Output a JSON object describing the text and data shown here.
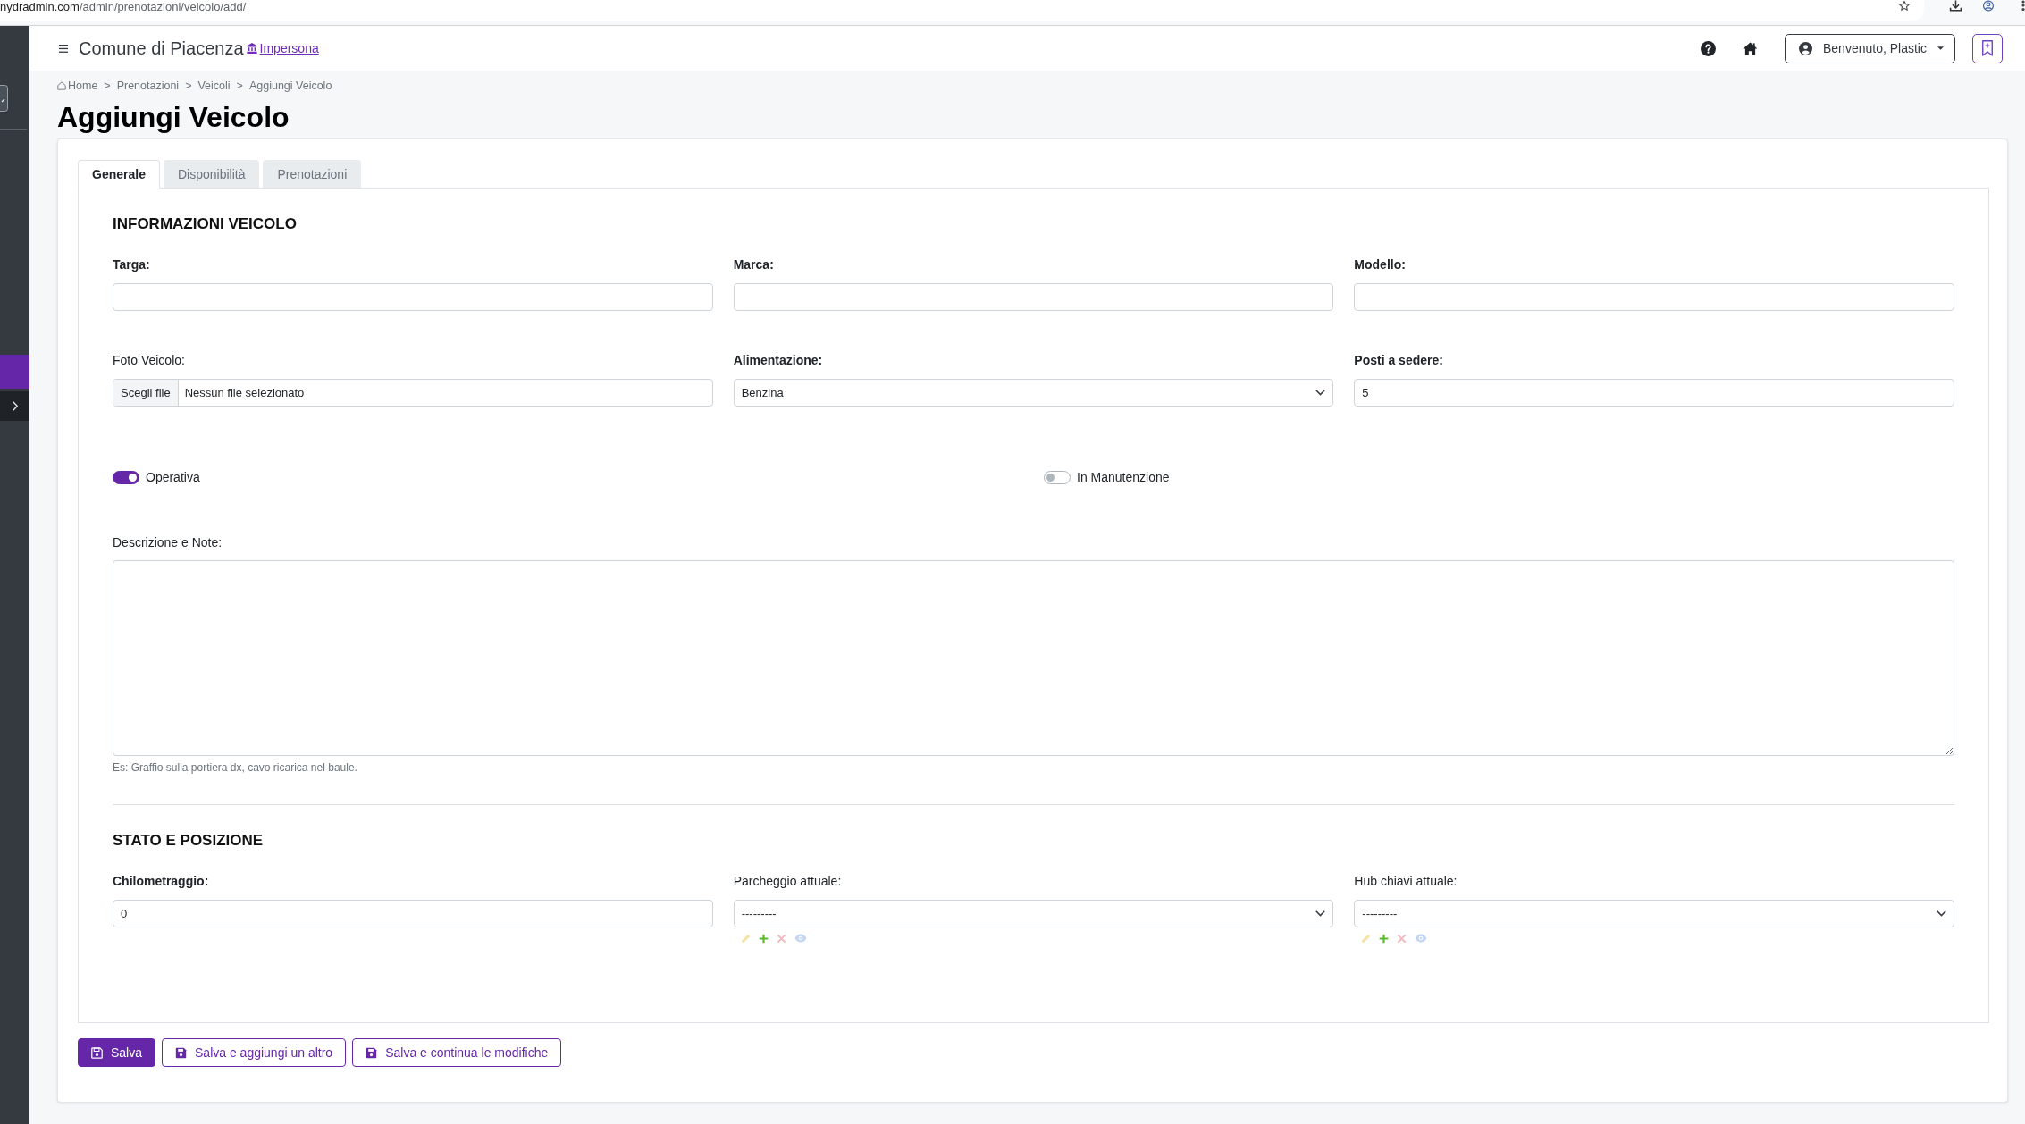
{
  "browser": {
    "address_host": "nydradmin.com",
    "address_path": "/admin/prenotazioni/veicolo/add/"
  },
  "sidebar": {
    "items": [
      {
        "selected": true
      }
    ]
  },
  "header": {
    "title": "Comune di Piacenza",
    "impersonate_link": "Impersona",
    "user_menu": "Benvenuto, Plastic"
  },
  "breadcrumb": [
    {
      "kind": "home",
      "label": "Home"
    },
    {
      "kind": "separator",
      "label": ">"
    },
    {
      "kind": "link",
      "label": "Prenotazioni"
    },
    {
      "kind": "separator",
      "label": ">"
    },
    {
      "kind": "link",
      "label": "Veicoli"
    },
    {
      "kind": "separator",
      "label": ">"
    },
    {
      "kind": "current",
      "label": "Aggiungi Veicolo"
    }
  ],
  "page_title": "Aggiungi Veicolo",
  "tabs": [
    {
      "label": "Generale",
      "selected": true
    },
    {
      "label": "Disponibilità",
      "selected": false
    },
    {
      "label": "Prenotazioni",
      "selected": false
    }
  ],
  "sections": [
    {
      "title": "INFORMAZIONI VEICOLO",
      "rows": [
        {
          "fields": [
            {
              "kind": "text",
              "label": "Targa:",
              "required": true
            },
            {
              "kind": "text",
              "label": "Marca:",
              "required": true
            },
            {
              "kind": "text",
              "label": "Modello:",
              "required": true
            }
          ]
        },
        {
          "fields": [
            {
              "kind": "file",
              "label": "Foto Veicolo:",
              "required": false,
              "button_label": "Scegli file",
              "value": "Nessun file selezionato"
            },
            {
              "kind": "select",
              "label": "Alimentazione:",
              "required": true,
              "value": "Benzina"
            },
            {
              "kind": "text",
              "label": "Posti a sedere:",
              "required": true,
              "value": "5"
            }
          ]
        },
        {
          "fields": [
            {
              "kind": "toggle",
              "label": "Operativa",
              "on": true
            },
            {
              "kind": "toggle",
              "label": "In Manutenzione",
              "on": false
            }
          ]
        },
        {
          "fields": [
            {
              "kind": "textarea",
              "label": "Descrizione e Note:",
              "required": false,
              "help": "Es: Graffio sulla portiera dx, cavo ricarica nel baule."
            }
          ]
        }
      ]
    },
    {
      "title": "STATO E POSIZIONE",
      "rows": [
        {
          "fields": [
            {
              "kind": "text",
              "label": "Chilometraggio:",
              "required": true,
              "value": "0"
            },
            {
              "kind": "select",
              "label": "Parcheggio attuale:",
              "required": false,
              "value": "---------",
              "actions": [
                {
                  "kind": "edit",
                  "disabled": true
                },
                {
                  "kind": "add",
                  "disabled": false
                },
                {
                  "kind": "delete",
                  "disabled": true
                },
                {
                  "kind": "view",
                  "disabled": true
                }
              ]
            },
            {
              "kind": "select",
              "label": "Hub chiavi attuale:",
              "required": false,
              "value": "---------",
              "actions": [
                {
                  "kind": "edit",
                  "disabled": true
                },
                {
                  "kind": "add",
                  "disabled": false
                },
                {
                  "kind": "delete",
                  "disabled": true
                },
                {
                  "kind": "view",
                  "disabled": true
                }
              ]
            }
          ]
        }
      ]
    }
  ],
  "buttons": [
    {
      "kind": "primary",
      "label": "Salva"
    },
    {
      "kind": "secondary",
      "label": "Salva e aggiungi un altro"
    },
    {
      "kind": "secondary",
      "label": "Salva e continua le modifiche"
    }
  ]
}
